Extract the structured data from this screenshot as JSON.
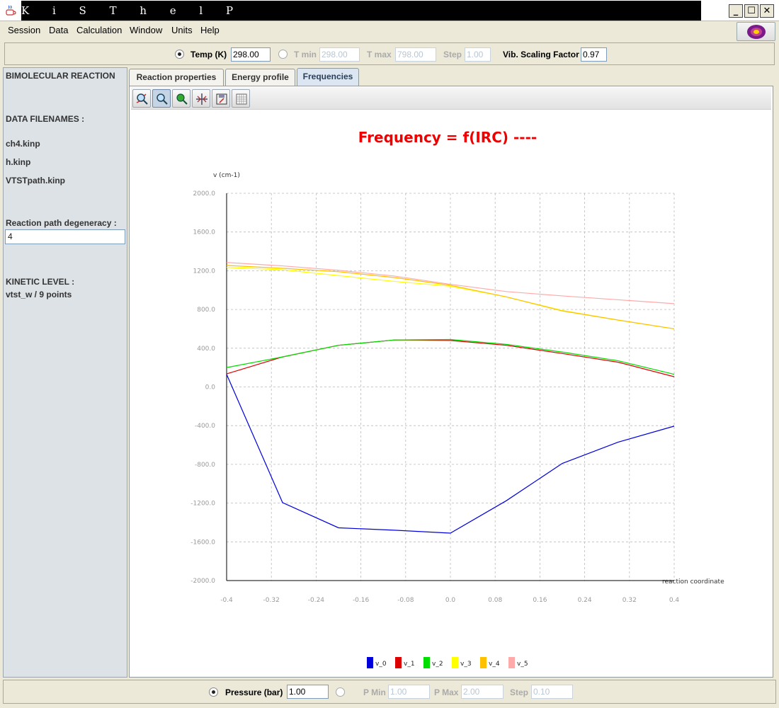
{
  "window": {
    "title": "K i S T h e l P"
  },
  "menu": {
    "items": [
      "Session",
      "Data",
      "Calculation",
      "Window",
      "Units",
      "Help"
    ]
  },
  "temperature_bar": {
    "temp_label": "Temp (K)",
    "temp_value": "298.00",
    "tmin_label": "T min",
    "tmin_value": "298.00",
    "tmax_label": "T max",
    "tmax_value": "798.00",
    "step_label": "Step",
    "step_value": "1.00",
    "vib_label": "Vib. Scaling Factor",
    "vib_value": "0.97"
  },
  "sidebar": {
    "reaction_type": "BIMOLECULAR REACTION",
    "filenames_label": "DATA FILENAMES :",
    "files": [
      "ch4.kinp",
      "h.kinp",
      "VTSTpath.kinp"
    ],
    "degeneracy_label": "Reaction path degeneracy :",
    "degeneracy_value": "4",
    "kinetic_label": "KINETIC LEVEL :",
    "kinetic_value": "vtst_w / 9 points"
  },
  "tabs": [
    {
      "label": "Reaction properties",
      "active": false
    },
    {
      "label": "Energy profile",
      "active": false
    },
    {
      "label": "Frequencies",
      "active": true
    }
  ],
  "toolbar_icons": [
    "zoom-in-icon",
    "magnifier-icon",
    "pan-icon",
    "cursor-icon",
    "save-icon",
    "grid-icon"
  ],
  "pressure_bar": {
    "pressure_label": "Pressure (bar)",
    "pressure_value": "1.00",
    "pmin_label": "P Min",
    "pmin_value": "1.00",
    "pmax_label": "P Max",
    "pmax_value": "2.00",
    "step_label": "Step",
    "step_value": "0.10"
  },
  "chart_data": {
    "type": "line",
    "title": "Frequency = f(IRC) ----",
    "ylabel": "v (cm-1)",
    "xlabel": "reaction coordinate",
    "xlim": [
      -0.4,
      0.4
    ],
    "ylim": [
      -2000,
      2000
    ],
    "xticks": [
      "-0.4",
      "-0.32",
      "-0.24",
      "-0.16",
      "-0.08",
      "0.0",
      "0.08",
      "0.16",
      "0.24",
      "0.32",
      "0.4"
    ],
    "yticks": [
      "2000.0",
      "1600.0",
      "1200.0",
      "800.0",
      "400.0",
      "0.0",
      "-400.0",
      "-800.0",
      "-1200.0",
      "-1600.0",
      "-2000.0"
    ],
    "grid": true,
    "legend_position": "bottom",
    "x": [
      -0.4,
      -0.3,
      -0.2,
      -0.1,
      0.0,
      0.1,
      0.2,
      0.3,
      0.4
    ],
    "series": [
      {
        "name": "v_0",
        "color": "#0000dd",
        "values": [
          130,
          -1195,
          -1455,
          -1480,
          -1510,
          -1175,
          -790,
          -570,
          -405
        ]
      },
      {
        "name": "v_1",
        "color": "#dd0000",
        "values": [
          135,
          310,
          430,
          485,
          480,
          430,
          345,
          255,
          105
        ]
      },
      {
        "name": "v_2",
        "color": "#00dd00",
        "values": [
          200,
          310,
          430,
          485,
          490,
          440,
          360,
          270,
          130
        ]
      },
      {
        "name": "v_3",
        "color": "#ffff00",
        "values": [
          1235,
          1210,
          1150,
          1090,
          1040,
          930,
          790,
          690,
          600
        ]
      },
      {
        "name": "v_4",
        "color": "#ffc000",
        "values": [
          1255,
          1225,
          1190,
          1130,
          1050,
          930,
          785,
          690,
          600
        ]
      },
      {
        "name": "v_5",
        "color": "#ffaaaa",
        "values": [
          1285,
          1250,
          1205,
          1145,
          1060,
          985,
          940,
          900,
          860
        ]
      }
    ]
  }
}
